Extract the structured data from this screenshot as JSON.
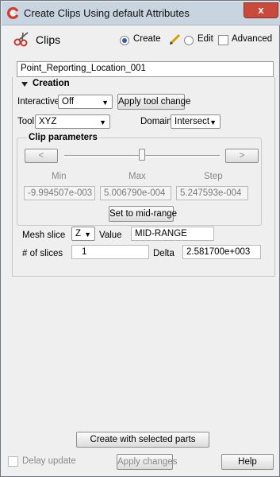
{
  "window": {
    "title": "Create Clips Using default Attributes",
    "close_symbol": "x"
  },
  "header": {
    "section": "Clips",
    "create_label": "Create",
    "edit_label": "Edit",
    "advanced_label": "Advanced"
  },
  "name_field": {
    "value": "Point_Reporting_Location_001"
  },
  "creation": {
    "title": "Creation",
    "interactive_label": "Interactive",
    "interactive_value": "Off",
    "apply_tool_change": "Apply tool change",
    "tool_label": "Tool",
    "tool_value": "XYZ",
    "domain_label": "Domain",
    "domain_value": "Intersect"
  },
  "clip_parameters": {
    "title": "Clip parameters",
    "prev": "<",
    "next": ">",
    "min_label": "Min",
    "max_label": "Max",
    "step_label": "Step",
    "min_value": "-9.994507e-003",
    "max_value": "5.006790e-004",
    "step_value": "5.247593e-004",
    "slider_position": 0.5,
    "set_mid_range": "Set to mid-range"
  },
  "mesh": {
    "slice_label": "Mesh slice",
    "slice_value": "Z",
    "value_label": "Value",
    "value": "MID-RANGE",
    "num_slices_label": "# of slices",
    "num_slices": "1",
    "delta_label": "Delta",
    "delta": "2.581700e+003"
  },
  "footer": {
    "create_parts": "Create with selected parts",
    "delay_update": "Delay update",
    "apply_changes": "Apply changes",
    "help": "Help"
  },
  "colors": {
    "accent": "#2d5fae",
    "close": "#c94a3b"
  },
  "icons": [
    "app-logo-icon",
    "close-icon",
    "scissors-icon",
    "pencil-icon",
    "triangle-down-icon",
    "chevron-down-icon"
  ]
}
